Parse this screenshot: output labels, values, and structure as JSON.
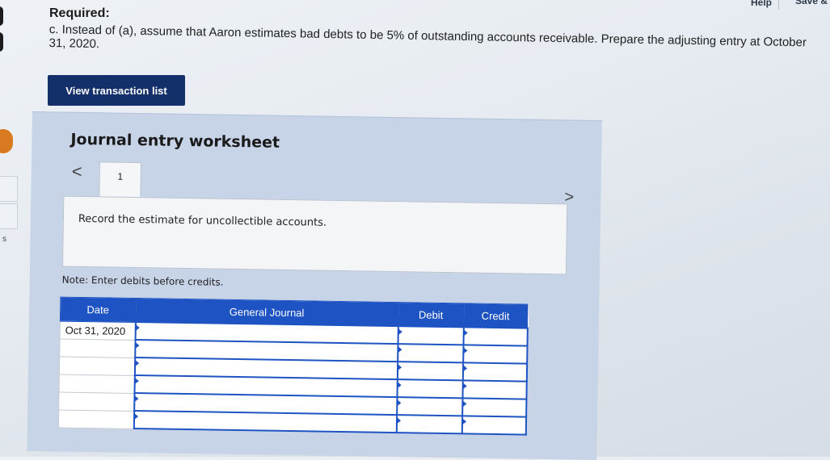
{
  "header": {
    "help_label": "Help",
    "save_label": "Save &"
  },
  "left_rail": {
    "letter": "s"
  },
  "question": {
    "required_label": "Required:",
    "text": "c. Instead of (a), assume that Aaron estimates bad debts to be 5% of outstanding accounts receivable. Prepare the adjusting entry at October 31, 2020."
  },
  "actions": {
    "view_transaction_list_label": "View transaction list"
  },
  "worksheet": {
    "title": "Journal entry worksheet",
    "prev_arrow": "<",
    "next_arrow": ">",
    "active_tab": "1",
    "instruction": "Record the estimate for uncollectible accounts.",
    "note": "Note: Enter debits before credits.",
    "table": {
      "columns": [
        "Date",
        "General Journal",
        "Debit",
        "Credit"
      ],
      "rows": [
        {
          "date": "Oct 31, 2020",
          "account": "",
          "debit": "",
          "credit": ""
        },
        {
          "date": "",
          "account": "",
          "debit": "",
          "credit": ""
        },
        {
          "date": "",
          "account": "",
          "debit": "",
          "credit": ""
        },
        {
          "date": "",
          "account": "",
          "debit": "",
          "credit": ""
        },
        {
          "date": "",
          "account": "",
          "debit": "",
          "credit": ""
        },
        {
          "date": "",
          "account": "",
          "debit": "",
          "credit": ""
        }
      ]
    }
  },
  "colors": {
    "button_bg": "#13306b",
    "table_header_bg": "#1d53c2",
    "worksheet_bg": "#c7d3e7",
    "accent_orange": "#d97a20"
  }
}
